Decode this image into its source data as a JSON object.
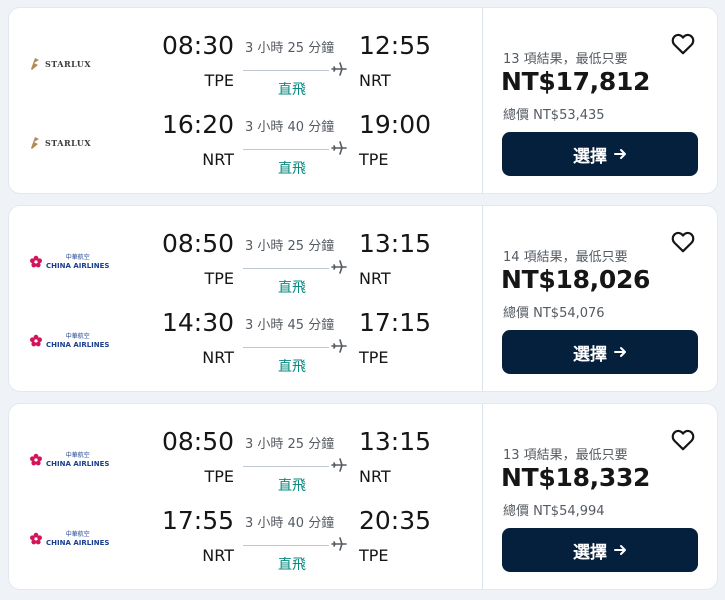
{
  "colors": {
    "button_bg": "#05203c",
    "direct_text": "#0a8a80",
    "heart": "#161616"
  },
  "results": [
    {
      "airline_logo": "starlux",
      "legs": [
        {
          "airline": "STARLUX",
          "dep_time": "08:30",
          "dep_code": "TPE",
          "duration": "3 小時 25 分鐘",
          "stops": "直飛",
          "arr_time": "12:55",
          "arr_code": "NRT"
        },
        {
          "airline": "STARLUX",
          "dep_time": "16:20",
          "dep_code": "NRT",
          "duration": "3 小時 40 分鐘",
          "stops": "直飛",
          "arr_time": "19:00",
          "arr_code": "TPE"
        }
      ],
      "results_text": "13 項結果，最低只要",
      "price": "NT$17,812",
      "total": "總價 NT$53,435",
      "select_label": "選擇"
    },
    {
      "airline_logo": "china-airlines",
      "legs": [
        {
          "airline": "CHINA AIRLINES",
          "airline_cn": "中華航空",
          "dep_time": "08:50",
          "dep_code": "TPE",
          "duration": "3 小時 25 分鐘",
          "stops": "直飛",
          "arr_time": "13:15",
          "arr_code": "NRT"
        },
        {
          "airline": "CHINA AIRLINES",
          "airline_cn": "中華航空",
          "dep_time": "14:30",
          "dep_code": "NRT",
          "duration": "3 小時 45 分鐘",
          "stops": "直飛",
          "arr_time": "17:15",
          "arr_code": "TPE"
        }
      ],
      "results_text": "14 項結果，最低只要",
      "price": "NT$18,026",
      "total": "總價 NT$54,076",
      "select_label": "選擇"
    },
    {
      "airline_logo": "china-airlines",
      "legs": [
        {
          "airline": "CHINA AIRLINES",
          "airline_cn": "中華航空",
          "dep_time": "08:50",
          "dep_code": "TPE",
          "duration": "3 小時 25 分鐘",
          "stops": "直飛",
          "arr_time": "13:15",
          "arr_code": "NRT"
        },
        {
          "airline": "CHINA AIRLINES",
          "airline_cn": "中華航空",
          "dep_time": "17:55",
          "dep_code": "NRT",
          "duration": "3 小時 40 分鐘",
          "stops": "直飛",
          "arr_time": "20:35",
          "arr_code": "TPE"
        }
      ],
      "results_text": "13 項結果，最低只要",
      "price": "NT$18,332",
      "total": "總價 NT$54,994",
      "select_label": "選擇"
    }
  ]
}
